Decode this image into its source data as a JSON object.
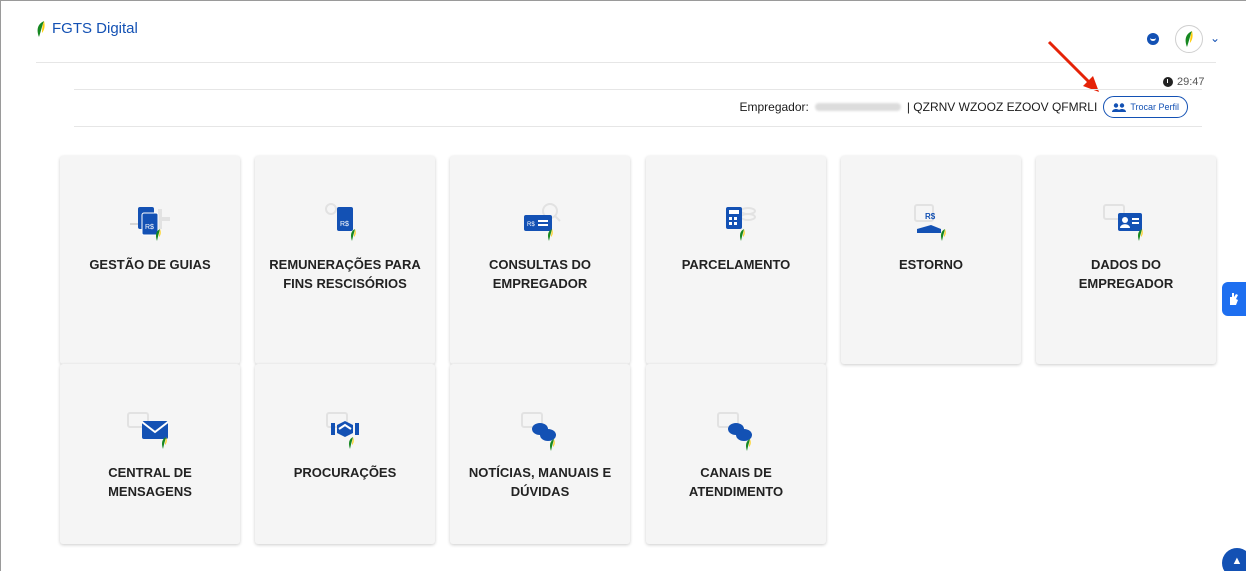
{
  "header": {
    "brand": "FGTS Digital"
  },
  "session": {
    "timer": "29:47"
  },
  "employer": {
    "label": "Empregador:",
    "name": "| QZRNV WZOOZ EZOOV QFMRLI",
    "switch_profile": "Trocar Perfil"
  },
  "cards": [
    {
      "label": "GESTÃO DE GUIAS",
      "icon": "guides-icon"
    },
    {
      "label": "REMUNERAÇÕES PARA FINS RESCISÓRIOS",
      "icon": "remuneration-icon"
    },
    {
      "label": "CONSULTAS DO EMPREGADOR",
      "icon": "consult-icon"
    },
    {
      "label": "PARCELAMENTO",
      "icon": "calculator-icon"
    },
    {
      "label": "ESTORNO",
      "icon": "refund-icon"
    },
    {
      "label": "DADOS DO EMPREGADOR",
      "icon": "employer-card-icon"
    },
    {
      "label": "CENTRAL DE MENSAGENS",
      "icon": "envelope-icon"
    },
    {
      "label": "PROCURAÇÕES",
      "icon": "handshake-icon"
    },
    {
      "label": "NOTÍCIAS, MANUAIS E DÚVIDAS",
      "icon": "chat-icon"
    },
    {
      "label": "CANAIS DE ATENDIMENTO",
      "icon": "chat-icon"
    }
  ],
  "colors": {
    "primary": "#1351b4",
    "leaf_green": "#168821",
    "leaf_yellow": "#ffcd07",
    "card_bg": "#f5f5f5",
    "annotation_red": "#e52207"
  }
}
